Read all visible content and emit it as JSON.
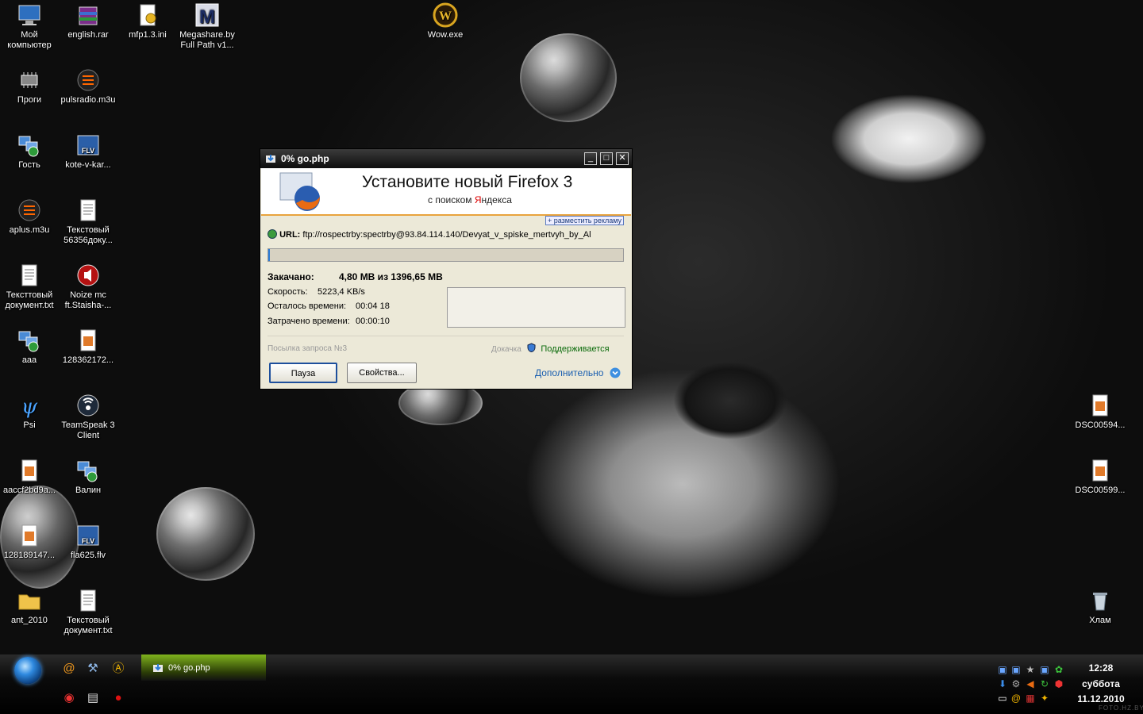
{
  "desktop_icons": [
    {
      "label": "Мой компьютер",
      "icon": "computer-icon"
    },
    {
      "label": "english.rar",
      "icon": "archive-icon"
    },
    {
      "label": "mfp1.3.ini",
      "icon": "settings-file-icon"
    },
    {
      "label": "Megashare.by Full Path v1...",
      "icon": "app-m-icon"
    },
    {
      "label": "Wow.exe",
      "icon": "wow-icon"
    },
    {
      "label": "Проги",
      "icon": "chip-icon"
    },
    {
      "label": "pulsradio.m3u",
      "icon": "playlist-icon"
    },
    {
      "label": "Гость",
      "icon": "network-user-icon"
    },
    {
      "label": "kote-v-kar...",
      "icon": "flv-icon"
    },
    {
      "label": "aplus.m3u",
      "icon": "playlist-icon"
    },
    {
      "label": "Текстовый 56356доку...",
      "icon": "text-file-icon"
    },
    {
      "label": "Тексттовый документ.txt",
      "icon": "text-file-icon"
    },
    {
      "label": "Noize mc ft.Staisha-...",
      "icon": "mp3-icon"
    },
    {
      "label": "aaa",
      "icon": "network-user-icon"
    },
    {
      "label": "128362172...",
      "icon": "image-file-icon"
    },
    {
      "label": "Psi",
      "icon": "psi-icon"
    },
    {
      "label": "TeamSpeak 3 Client",
      "icon": "teamspeak-icon"
    },
    {
      "label": "aaccf2bd9a...",
      "icon": "image-file-icon"
    },
    {
      "label": "Валин",
      "icon": "network-user-icon"
    },
    {
      "label": "128189147...",
      "icon": "image-file-icon"
    },
    {
      "label": "fla625.flv",
      "icon": "flv-icon"
    },
    {
      "label": "ant_2010",
      "icon": "folder-icon"
    },
    {
      "label": "Текстовый документ.txt",
      "icon": "text-file-icon"
    },
    {
      "label": "DSC00594...",
      "icon": "image-file-icon"
    },
    {
      "label": "DSC00599...",
      "icon": "image-file-icon"
    },
    {
      "label": "Хлам",
      "icon": "recycle-bin-icon"
    }
  ],
  "dialog": {
    "title": "0% go.php",
    "banner": {
      "headline": "Установите новый Firefox 3",
      "sub_prefix": "с поиском ",
      "sub_brand_first": "Я",
      "sub_brand_rest": "ндекса"
    },
    "ad_link": "+ разместить рекламу",
    "url_label": "URL:",
    "url_value": "ftp://rospectrby:spectrby@93.84.114.140/Devyat_v_spiske_mertvyh_by_Al",
    "progress_percent": 0.34,
    "downloaded_label": "Закачано:",
    "downloaded_value": "4,80 MB из 1396,65 MB",
    "speed_label": "Скорость:",
    "speed_value": "5223,4 KB/s",
    "remaining_label": "Осталось времени:",
    "remaining_value": "00:04 18",
    "elapsed_label": "Затрачено времени:",
    "elapsed_value": "00:00:10",
    "request_status": "Посылка запроса №3",
    "resume_label": "Докачка",
    "resume_value": "Поддерживается",
    "pause_button": "Пауза",
    "properties_button": "Свойства...",
    "more_link": "Дополнительно"
  },
  "taskbar": {
    "task_label": "0% go.php",
    "time": "12:28",
    "day": "суббота",
    "date": "11.12.2010"
  },
  "watermark": "FOTO.HZ.BY",
  "colors": {
    "accent_progress": "#2b7bd4",
    "task_active": "#7fb31d",
    "link": "#1a5fb0"
  }
}
